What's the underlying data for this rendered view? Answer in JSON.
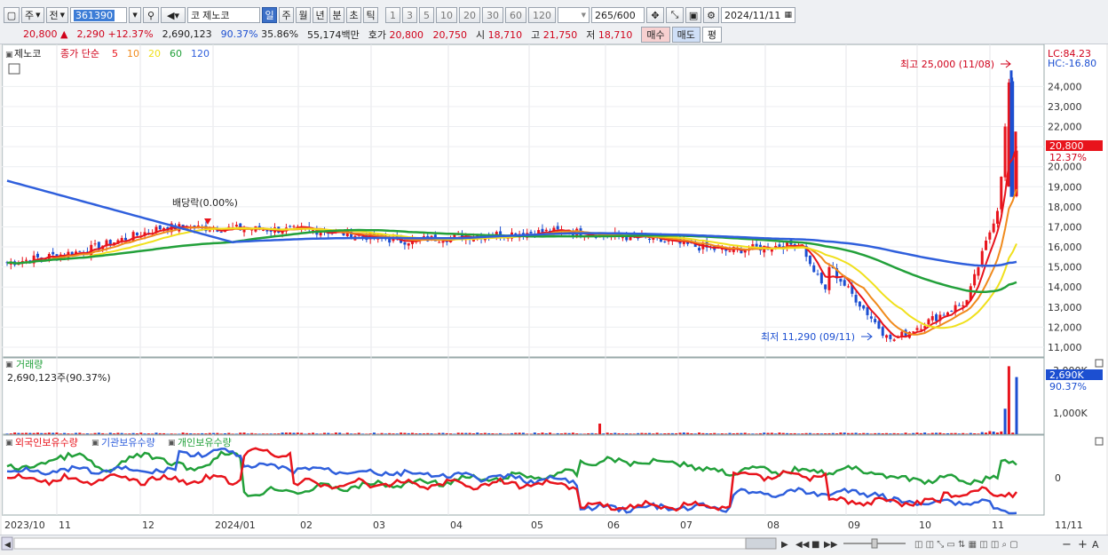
{
  "toolbar": {
    "market": "주",
    "prev_label": "전",
    "code": "361390",
    "name_prefix": "코",
    "stock_name": "제노코",
    "periods": [
      "일",
      "주",
      "월",
      "년",
      "분",
      "초",
      "틱"
    ],
    "period_selected": "일",
    "intervals": [
      "1",
      "3",
      "5",
      "10",
      "20",
      "30",
      "60",
      "120"
    ],
    "count": "265",
    "count_total": "/600",
    "date": "2024/11/11"
  },
  "quote": {
    "price": "20,800",
    "arrow": "▲",
    "change": "2,290",
    "change_pct": "+12.37%",
    "volume": "2,690,123",
    "vol_ratio": "90.37%",
    "turnover": "35.86%",
    "amount": "55,174백만",
    "hoga_label": "호가",
    "ask": "20,800",
    "bid": "20,750",
    "open_label": "시",
    "open": "18,710",
    "high_label": "고",
    "high": "21,750",
    "low_label": "저",
    "low": "18,710",
    "buy": "매수",
    "sell": "매도",
    "avg": "평"
  },
  "legend": {
    "name": "제노코",
    "ma_label": "종가 단순",
    "ma": [
      {
        "period": "5",
        "color": "#e8141c"
      },
      {
        "period": "10",
        "color": "#f08a1c"
      },
      {
        "period": "20",
        "color": "#f0e01c"
      },
      {
        "period": "60",
        "color": "#22a03a"
      },
      {
        "period": "120",
        "color": "#2f5fdc"
      }
    ]
  },
  "price_panel": {
    "y_ticks": [
      "24,000",
      "23,000",
      "22,000",
      "21,000",
      "20,000",
      "19,000",
      "18,000",
      "17,000",
      "16,000",
      "15,000",
      "14,000",
      "13,000",
      "12,000",
      "11,000"
    ],
    "lc": "LC:84.23",
    "hc": "HC:-16.80",
    "current_tag": "20,800",
    "current_pct": "12.37%",
    "high_marker": "최고 25,000 (11/08)",
    "low_marker": "최저 11,290 (09/11)",
    "dividend_marker": "배당락(0.00%)"
  },
  "volume_panel": {
    "title": "거래량",
    "info": "2,690,123주(90.37%)",
    "y_ticks": [
      "3,000K",
      "1,000K"
    ],
    "current_tag": "2,690K",
    "current_pct": "90.37%"
  },
  "holder_panel": {
    "legend": [
      {
        "label": "외국인보유수량",
        "color": "#e8141c"
      },
      {
        "label": "기관보유수량",
        "color": "#2f5fdc"
      },
      {
        "label": "개인보유수량",
        "color": "#22a03a"
      }
    ],
    "zero": "0"
  },
  "x_labels": [
    "2023/10",
    "11",
    "12",
    "2024/01",
    "02",
    "03",
    "04",
    "05",
    "06",
    "07",
    "08",
    "09",
    "10",
    "11",
    "11/11"
  ],
  "chart_data": {
    "type": "line",
    "ylim": [
      10600,
      25300
    ],
    "x": [
      "2023/10",
      "11",
      "12",
      "2024/01",
      "02",
      "03",
      "04",
      "05",
      "06",
      "07",
      "08",
      "09",
      "10",
      "11"
    ],
    "series": [
      {
        "name": "종가",
        "values": [
          15200,
          15800,
          17000,
          16900,
          16800,
          16300,
          16600,
          16800,
          16400,
          15800,
          16200,
          11300,
          13300,
          20800
        ]
      }
    ]
  }
}
